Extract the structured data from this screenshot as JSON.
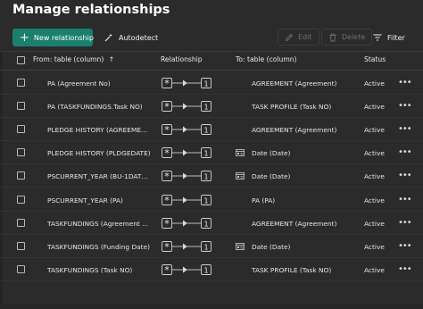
{
  "title": "Manage relationships",
  "toolbar": {
    "new_label": "New relationship",
    "autodetect_label": "Autodetect",
    "edit_label": "Edit",
    "delete_label": "Delete",
    "filter_label": "Filter"
  },
  "columns": {
    "from": "From: table (column)",
    "sort_indicator": "↑",
    "relationship": "Relationship",
    "to": "To: table (column)",
    "status": "Status"
  },
  "relationship_symbols": {
    "many": "*",
    "one": "1"
  },
  "rows": [
    {
      "from": "PA (Agreement No)",
      "to": "AGREEMENT (Agreement)",
      "to_icon": "none",
      "status": "Active",
      "more": "•••"
    },
    {
      "from": "PA (TASKFUNDINGS.Task NO)",
      "to": "TASK PROFILE (Task NO)",
      "to_icon": "none",
      "status": "Active",
      "more": "•••"
    },
    {
      "from": "PLEDGE HISTORY (AGREEMENT)",
      "to": "AGREEMENT (Agreement)",
      "to_icon": "none",
      "status": "Active",
      "more": "•••"
    },
    {
      "from": "PLEDGE HISTORY (PLDGEDATE)",
      "to": "Date (Date)",
      "to_icon": "calendar-table-icon",
      "status": "Active",
      "more": "•••"
    },
    {
      "from": "PSCURRENT_YEAR (BU-1DATE...",
      "to": "Date (Date)",
      "to_icon": "calendar-table-icon",
      "status": "Active",
      "more": "•••"
    },
    {
      "from": "PSCURRENT_YEAR (PA)",
      "to": "PA (PA)",
      "to_icon": "none",
      "status": "Active",
      "more": "•••"
    },
    {
      "from": "TASKFUNDINGS (Agreement ...",
      "to": "AGREEMENT (Agreement)",
      "to_icon": "none",
      "status": "Active",
      "more": "•••"
    },
    {
      "from": "TASKFUNDINGS (Funding Date)",
      "to": "Date (Date)",
      "to_icon": "calendar-table-icon",
      "status": "Active",
      "more": "•••"
    },
    {
      "from": "TASKFUNDINGS (Task NO)",
      "to": "TASK PROFILE (Task NO)",
      "to_icon": "none",
      "status": "Active",
      "more": "•••"
    }
  ],
  "colors": {
    "accent": "#1a7f6e",
    "background": "#2b2b2b"
  }
}
